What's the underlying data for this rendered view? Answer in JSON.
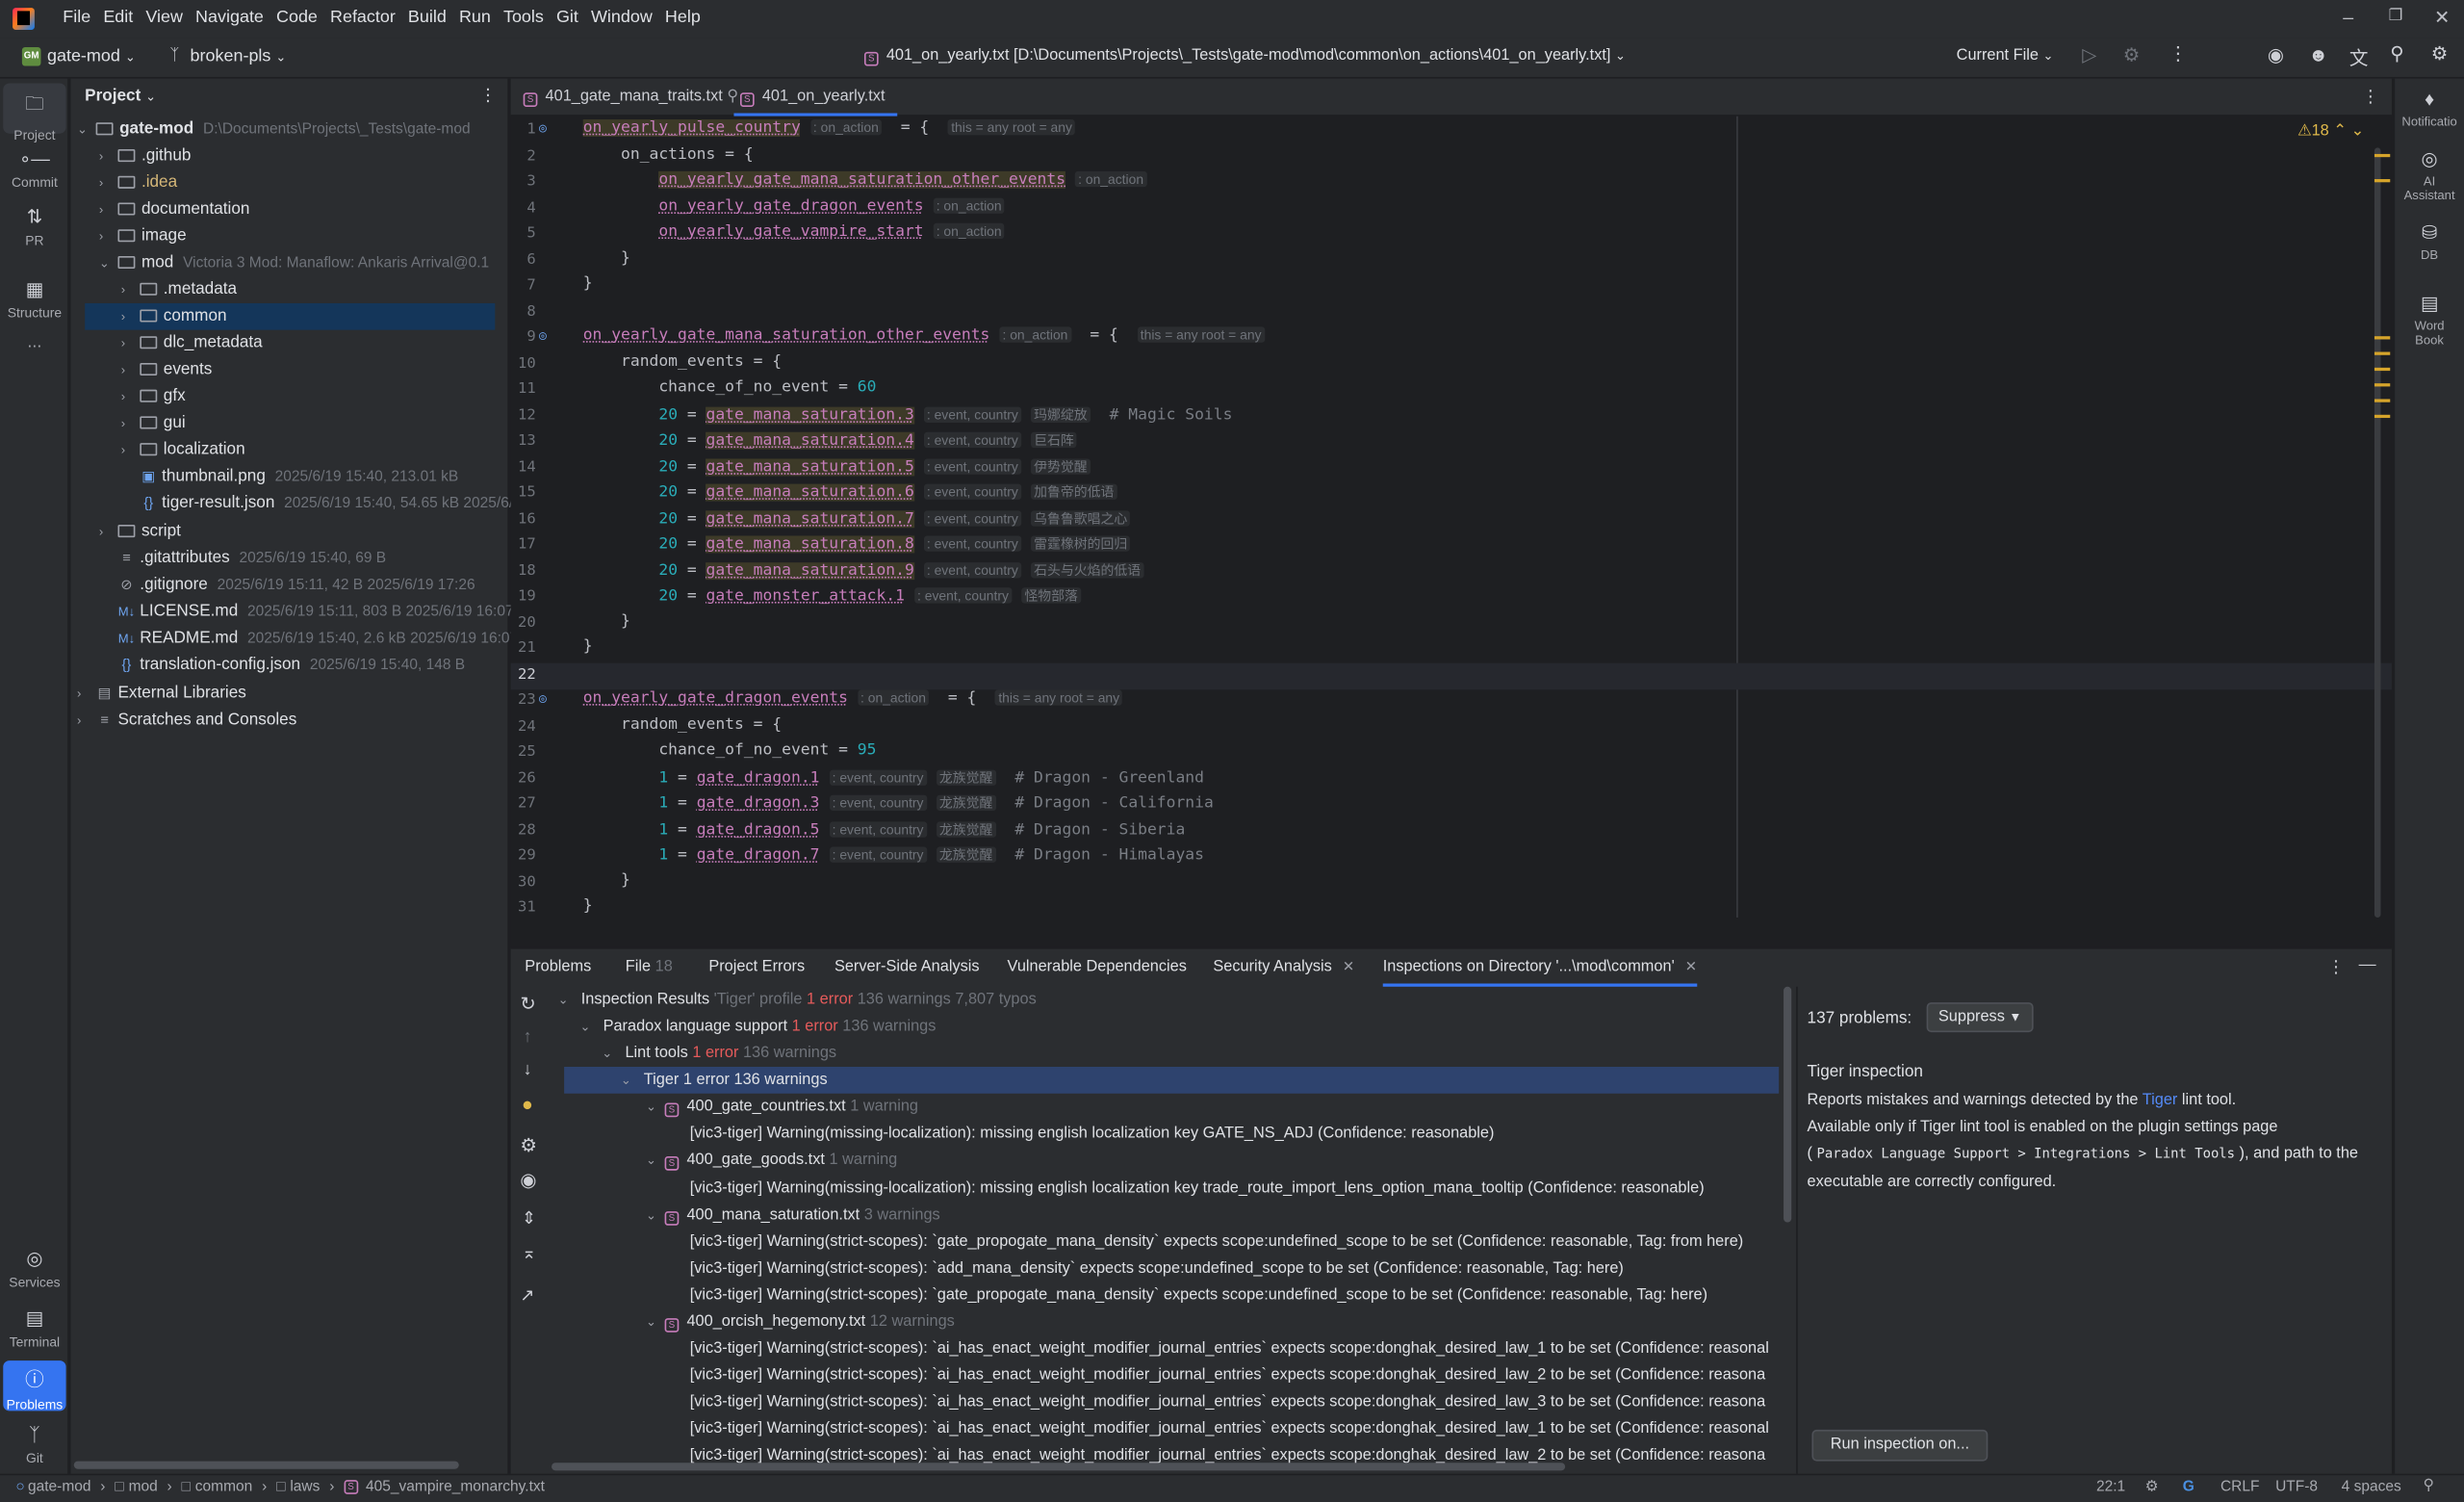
{
  "menu": {
    "items": [
      "File",
      "Edit",
      "View",
      "Navigate",
      "Code",
      "Refactor",
      "Build",
      "Run",
      "Tools",
      "Git",
      "Window",
      "Help"
    ]
  },
  "toolbar": {
    "project": "gate-mod",
    "project_badge": "GM",
    "branch": "broken-pls",
    "title": "401_on_yearly.txt [D:\\Documents\\Projects\\_Tests\\gate-mod\\mod\\common\\on_actions\\401_on_yearly.txt]",
    "run_config": "Current File"
  },
  "left_strip": {
    "project": "Project",
    "commit": "Commit",
    "pr": "PR",
    "structure": "Structure",
    "more": "...",
    "services": "Services",
    "terminal": "Terminal",
    "problems": "Problems",
    "git": "Git"
  },
  "project_panel": {
    "title": "Project",
    "rows": [
      {
        "label": "gate-mod",
        "meta": "D:\\Documents\\Projects\\_Tests\\gate-mod"
      },
      {
        "label": ".github",
        "meta": ""
      },
      {
        "label": ".idea",
        "meta": ""
      },
      {
        "label": "documentation",
        "meta": ""
      },
      {
        "label": "image",
        "meta": ""
      },
      {
        "label": "mod",
        "meta": "Victoria 3 Mod: Manaflow: Ankaris Arrival@0.1"
      },
      {
        "label": ".metadata",
        "meta": ""
      },
      {
        "label": "common",
        "meta": ""
      },
      {
        "label": "dlc_metadata",
        "meta": ""
      },
      {
        "label": "events",
        "meta": ""
      },
      {
        "label": "gfx",
        "meta": ""
      },
      {
        "label": "gui",
        "meta": ""
      },
      {
        "label": "localization",
        "meta": ""
      },
      {
        "label": "thumbnail.png",
        "meta": "2025/6/19 15:40, 213.01 kB"
      },
      {
        "label": "tiger-result.json",
        "meta": "2025/6/19 15:40, 54.65 kB 2025/6/1"
      },
      {
        "label": "script",
        "meta": ""
      },
      {
        "label": ".gitattributes",
        "meta": "2025/6/19 15:40, 69 B"
      },
      {
        "label": ".gitignore",
        "meta": "2025/6/19 15:11, 42 B 2025/6/19 17:26"
      },
      {
        "label": "LICENSE.md",
        "meta": "2025/6/19 15:11, 803 B 2025/6/19 16:07"
      },
      {
        "label": "README.md",
        "meta": "2025/6/19 15:40, 2.6 kB 2025/6/19 16:07"
      },
      {
        "label": "translation-config.json",
        "meta": "2025/6/19 15:40, 148 B"
      },
      {
        "label": "External Libraries",
        "meta": ""
      },
      {
        "label": "Scratches and Consoles",
        "meta": ""
      }
    ]
  },
  "editor": {
    "tabs": [
      "401_gate_mana_traits.txt",
      "401_on_yearly.txt"
    ],
    "warnings": "18",
    "hints": {
      "on_action": ": on_action",
      "scope": "this = any root = any",
      "event_country": ": event, country"
    },
    "lines": {
      "l1": "on_yearly_pulse_country",
      "l3": "on_yearly_gate_mana_saturation_other_events",
      "l4": "on_yearly_gate_dragon_events",
      "l5": "on_yearly_gate_vampire_start",
      "l12": "gate_mana_saturation.3",
      "l12c": "玛娜绽放",
      "l12m": "# Magic Soils",
      "l13": "gate_mana_saturation.4",
      "l13c": "巨石阵",
      "l14": "gate_mana_saturation.5",
      "l14c": "伊势觉醒",
      "l15": "gate_mana_saturation.6",
      "l15c": "加鲁帝的低语",
      "l16": "gate_mana_saturation.7",
      "l16c": "乌鲁鲁歌唱之心",
      "l17": "gate_mana_saturation.8",
      "l17c": "雷霆橡树的回归",
      "l18": "gate_mana_saturation.9",
      "l18c": "石头与火焰的低语",
      "l19": "gate_monster_attack.1",
      "l19c": "怪物部落",
      "l26": "gate_dragon.1",
      "l26m": "# Dragon - Greenland",
      "l27": "gate_dragon.3",
      "l27m": "# Dragon - California",
      "l28": "gate_dragon.5",
      "l28m": "# Dragon - Siberia",
      "l29": "gate_dragon.7",
      "l29m": "# Dragon - Himalayas",
      "dragon_c": "龙族觉醒",
      "chance60": "60",
      "chance95": "95"
    }
  },
  "problems": {
    "tabs": [
      "Problems",
      "File",
      "Project Errors",
      "Server-Side Analysis",
      "Vulnerable Dependencies",
      "Security Analysis",
      "Inspections on Directory '...\\mod\\common'"
    ],
    "file_count": "18",
    "tree": {
      "root": "Inspection Results",
      "root_profile": "'Tiger' profile",
      "root_err": "1 error",
      "root_rest": "136 warnings 7,807 typos",
      "pls": "Paradox language support",
      "lint": "Lint tools",
      "tiger": "Tiger",
      "err": "1 error",
      "w136": "136 warnings",
      "tiger_rest": "1 error 136 warnings",
      "f1": "400_gate_countries.txt",
      "f1w": "1 warning",
      "f1a": "[vic3-tiger] Warning(missing-localization): missing english localization key GATE_NS_ADJ (Confidence: reasonable)",
      "f2": "400_gate_goods.txt",
      "f2w": "1 warning",
      "f2a": "[vic3-tiger] Warning(missing-localization): missing english localization key trade_route_import_lens_option_mana_tooltip (Confidence: reasonable)",
      "f3": "400_mana_saturation.txt",
      "f3w": "3 warnings",
      "f3a": "[vic3-tiger] Warning(strict-scopes): `gate_propogate_mana_density` expects scope:undefined_scope to be set (Confidence: reasonable, Tag: from here)",
      "f3b": "[vic3-tiger] Warning(strict-scopes): `add_mana_density` expects scope:undefined_scope to be set (Confidence: reasonable, Tag: here)",
      "f3c": "[vic3-tiger] Warning(strict-scopes): `gate_propogate_mana_density` expects scope:undefined_scope to be set (Confidence: reasonable, Tag: here)",
      "f4": "400_orcish_hegemony.txt",
      "f4w": "12 warnings",
      "f4a": "[vic3-tiger] Warning(strict-scopes): `ai_has_enact_weight_modifier_journal_entries` expects scope:donghak_desired_law_1 to be set (Confidence: reasonal",
      "f4b": "[vic3-tiger] Warning(strict-scopes): `ai_has_enact_weight_modifier_journal_entries` expects scope:donghak_desired_law_2 to be set (Confidence: reasona",
      "f4c": "[vic3-tiger] Warning(strict-scopes): `ai_has_enact_weight_modifier_journal_entries` expects scope:donghak_desired_law_3 to be set (Confidence: reasona",
      "f4d": "[vic3-tiger] Warning(strict-scopes): `ai_has_enact_weight_modifier_journal_entries` expects scope:donghak_desired_law_1 to be set (Confidence: reasonal",
      "f4e": "[vic3-tiger] Warning(strict-scopes): `ai_has_enact_weight_modifier_journal_entries` expects scope:donghak_desired_law_2 to be set (Confidence: reasona"
    },
    "detail": {
      "count": "137 problems:",
      "suppress": "Suppress",
      "title": "Tiger inspection",
      "p1a": "Reports mistakes and warnings detected by the",
      "p1link": "Tiger",
      "p1b": "lint tool.",
      "p2a": "Available only if Tiger lint tool is enabled on the plugin settings page",
      "p2b": "(",
      "p2code": "Paradox Language Support > Integrations > Lint Tools",
      "p2c": "), and path to the",
      "p2d": "executable are correctly configured.",
      "run": "Run inspection on..."
    }
  },
  "right_strip": {
    "notifications": "Notificatio",
    "ai1": "AI",
    "ai2": "Assistant",
    "db": "DB",
    "wb1": "Word",
    "wb2": "Book"
  },
  "status": {
    "crumbs": [
      "gate-mod",
      "mod",
      "common",
      "laws",
      "405_vampire_monarchy.txt"
    ],
    "pos": "22:1",
    "eol": "CRLF",
    "enc": "UTF-8",
    "indent": "4 spaces"
  }
}
